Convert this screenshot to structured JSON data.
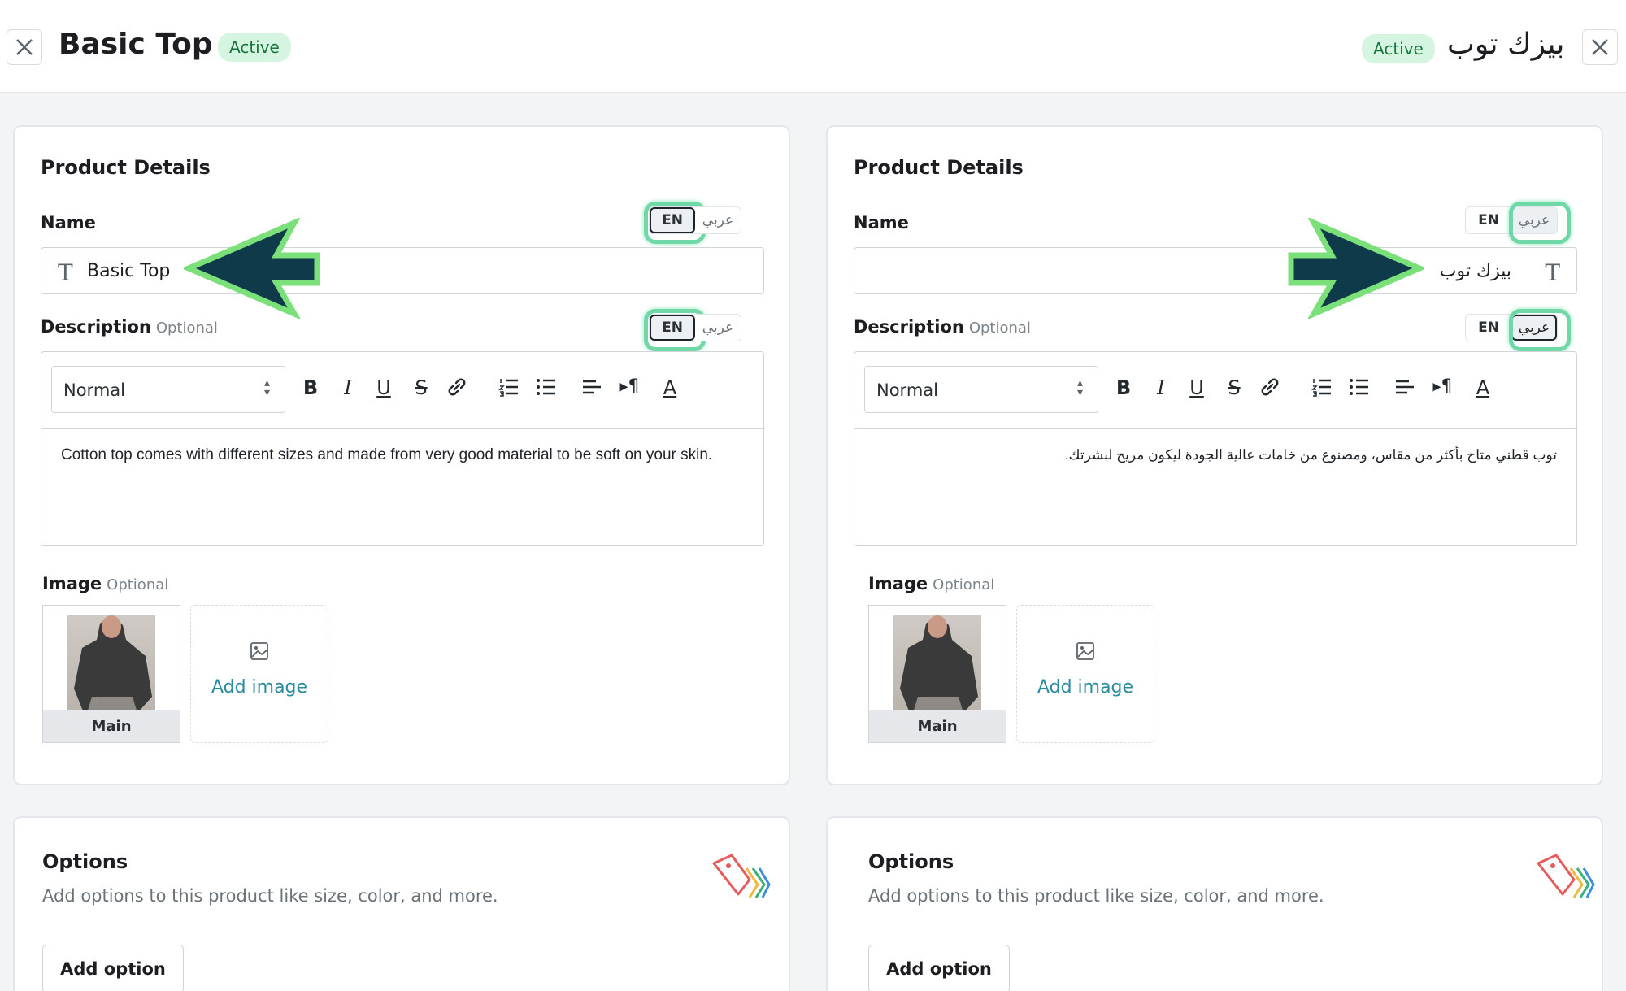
{
  "header": {
    "left_title": "Basic Top",
    "left_status": "Active",
    "right_title": "بيزك توب",
    "right_status": "Active"
  },
  "lang_toggle": {
    "en": "EN",
    "ar": "عربي"
  },
  "panels": {
    "en": {
      "section_title": "Product Details",
      "name_label": "Name",
      "name_value": "Basic Top",
      "description_label": "Description",
      "optional": "Optional",
      "format_select": "Normal",
      "description_text": "Cotton top comes with different sizes and made from very good material to be soft on your skin.",
      "image_label": "Image",
      "main_label": "Main",
      "add_image": "Add image"
    },
    "ar": {
      "section_title": "Product Details",
      "name_label": "Name",
      "name_value": "بيزك توب",
      "description_label": "Description",
      "optional": "Optional",
      "format_select": "Normal",
      "description_text": "توب قطني متاح بأكثر من مقاس، ومصنوع من خامات عالية الجودة ليكون مريح لبشرتك.",
      "image_label": "Image",
      "main_label": "Main",
      "add_image": "Add image"
    }
  },
  "options": {
    "title": "Options",
    "subtitle": "Add options to this product like size, color, and more.",
    "button": "Add option"
  },
  "colors": {
    "active_badge_bg": "#d6f5e0",
    "active_badge_text": "#17753f",
    "highlight": "#6fd8a6",
    "arrow_fill": "#0f3a4a",
    "arrow_outline": "#7be07a",
    "link": "#2a8ba0"
  },
  "icons": [
    "close-icon",
    "text-type-icon",
    "bold-icon",
    "italic-icon",
    "underline-icon",
    "strikethrough-icon",
    "link-icon",
    "ordered-list-icon",
    "bullet-list-icon",
    "align-icon",
    "text-direction-icon",
    "font-color-icon",
    "image-icon",
    "tags-icon"
  ]
}
